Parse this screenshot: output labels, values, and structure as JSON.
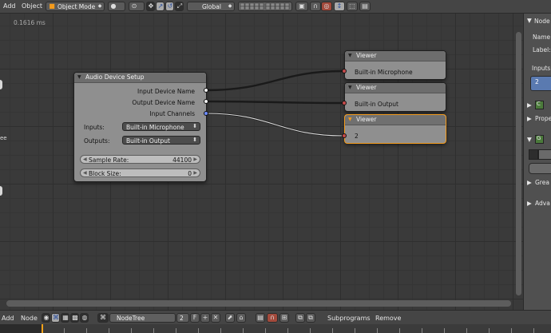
{
  "topbar": {
    "menu_add": "Add",
    "menu_object": "Object",
    "mode": "Object Mode",
    "orientation": "Global"
  },
  "canvas": {
    "timing": "0.1616 ms",
    "left_partial_label": "ee"
  },
  "nodes": {
    "audio_device_setup": {
      "title": "Audio Device Setup",
      "outputs": [
        "Input Device Name",
        "Output Device Name",
        "Input Channels"
      ],
      "inputs_label": "Inputs:",
      "inputs_value": "Built-in Microphone",
      "outputs_label": "Outputs:",
      "outputs_value": "Built-in Output",
      "sample_rate_label": "Sample Rate:",
      "sample_rate_value": "44100",
      "block_size_label": "Block Size:",
      "block_size_value": "0"
    },
    "viewer1": {
      "title": "Viewer",
      "value": "Built-in Microphone"
    },
    "viewer2": {
      "title": "Viewer",
      "value": "Built-in Output"
    },
    "viewer3": {
      "title": "Viewer",
      "value": "2"
    }
  },
  "right_panel": {
    "node_label": "Node",
    "name_label": "Name:",
    "label_label": "Label:",
    "inputs_label": "Inputs",
    "input_value": "2",
    "section_c": "C",
    "section_properties": "Prope",
    "section_g": "G",
    "section_grease": "Grea",
    "section_advanced": "Adva"
  },
  "bottombar": {
    "menu_add": "Add",
    "menu_node": "Node",
    "tree_name": "NodeTree",
    "users_count": "2",
    "subprograms": "Subprograms",
    "remove": "Remove"
  },
  "colors": {
    "accent_orange": "#f49b1c",
    "socket_white": "#f2f2f2",
    "socket_blue": "#6d8cff",
    "socket_red": "#c44b4b"
  }
}
